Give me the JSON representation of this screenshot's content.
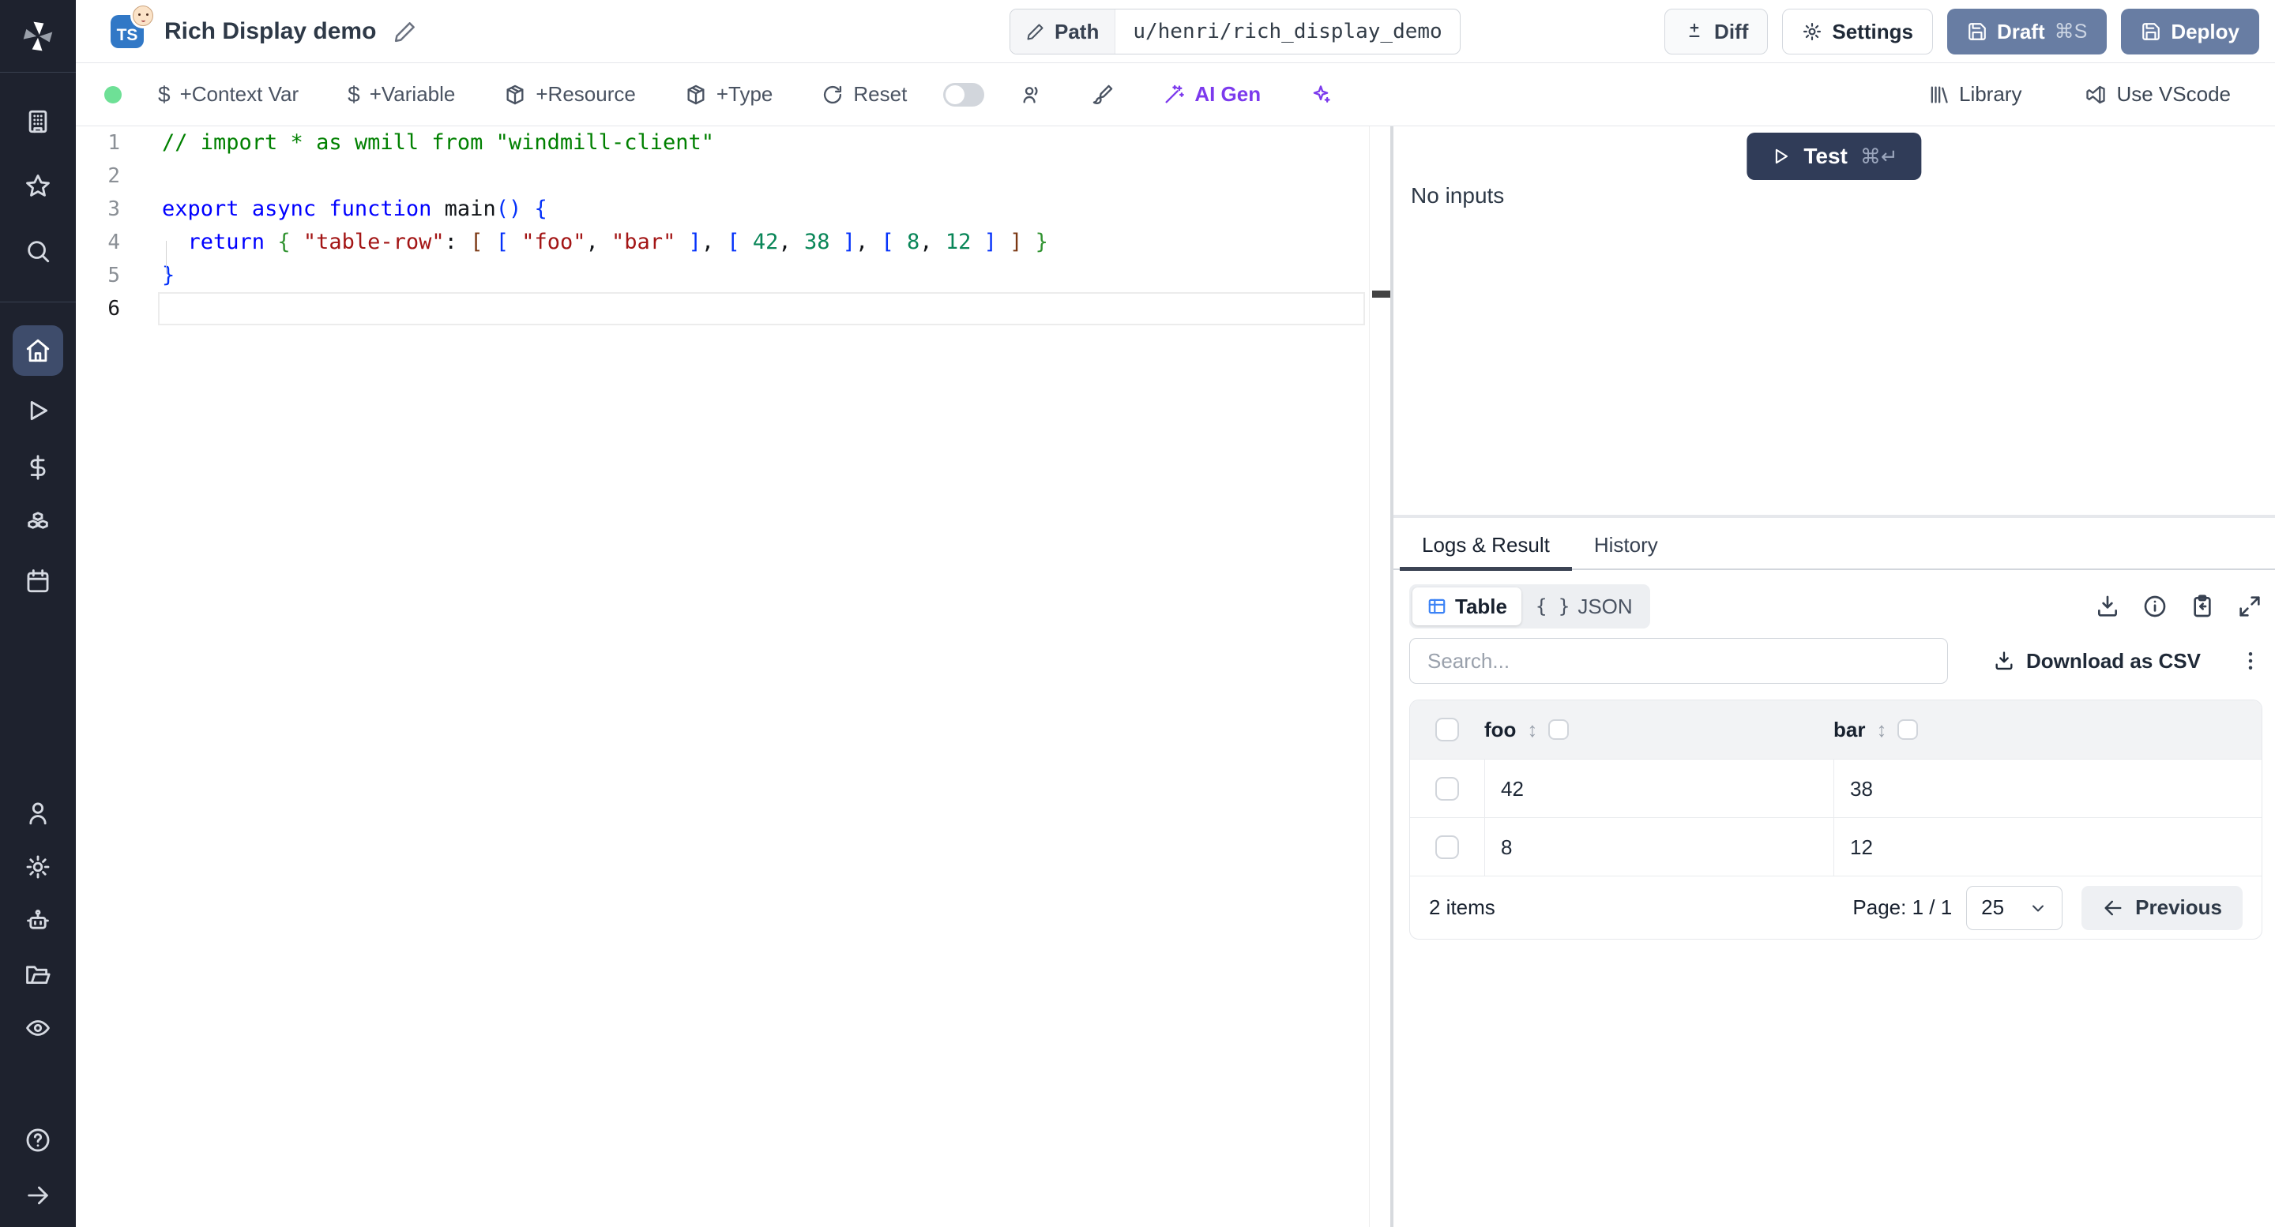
{
  "colors": {
    "sidebar_bg": "#1e222e",
    "sidebar_active_bg": "#3e4c6b",
    "primary_button": "#687da3",
    "test_button": "#303c58",
    "ai_accent": "#7c3aed",
    "ts_badge": "#3178c6",
    "status_green": "#6ee096",
    "table_icon_blue": "#3b82f6"
  },
  "sidebar": {
    "icons": [
      "windmill-logo",
      "building",
      "star",
      "search",
      "home",
      "play",
      "dollar",
      "boxes",
      "calendar",
      "user",
      "settings",
      "bot",
      "folder-open",
      "eye",
      "help",
      "expand-arrow"
    ]
  },
  "header": {
    "title": "Rich Display demo",
    "lang_badge": "TS",
    "path_label": "Path",
    "path_value": "u/henri/rich_display_demo",
    "diff_label": "Diff",
    "settings_label": "Settings",
    "draft_label": "Draft",
    "draft_shortcut": "⌘S",
    "deploy_label": "Deploy"
  },
  "toolbar": {
    "context_var": "+Context Var",
    "variable": "+Variable",
    "resource": "+Resource",
    "type": "+Type",
    "reset": "Reset",
    "ai_gen": "AI Gen",
    "library": "Library",
    "vscode": "Use VScode"
  },
  "editor": {
    "lines": [
      {
        "num": "1",
        "tokens": [
          {
            "t": "// import * as wmill from \"windmill-client\"",
            "c": "comment"
          }
        ]
      },
      {
        "num": "2",
        "tokens": []
      },
      {
        "num": "3",
        "tokens": [
          {
            "t": "export",
            "c": "kw"
          },
          {
            "t": " ",
            "c": "d"
          },
          {
            "t": "async",
            "c": "kw"
          },
          {
            "t": " ",
            "c": "d"
          },
          {
            "t": "function",
            "c": "kw"
          },
          {
            "t": " ",
            "c": "d"
          },
          {
            "t": "main",
            "c": "d"
          },
          {
            "t": "() {",
            "c": "b1"
          }
        ]
      },
      {
        "num": "4",
        "tokens": [
          {
            "t": "  ",
            "c": "d"
          },
          {
            "t": "return",
            "c": "kw"
          },
          {
            "t": " ",
            "c": "d"
          },
          {
            "t": "{",
            "c": "b2"
          },
          {
            "t": " ",
            "c": "d"
          },
          {
            "t": "\"table-row\"",
            "c": "str"
          },
          {
            "t": ": ",
            "c": "d"
          },
          {
            "t": "[",
            "c": "b3"
          },
          {
            "t": " ",
            "c": "d"
          },
          {
            "t": "[",
            "c": "b1"
          },
          {
            "t": " ",
            "c": "d"
          },
          {
            "t": "\"foo\"",
            "c": "str"
          },
          {
            "t": ", ",
            "c": "d"
          },
          {
            "t": "\"bar\"",
            "c": "str"
          },
          {
            "t": " ",
            "c": "d"
          },
          {
            "t": "]",
            "c": "b1"
          },
          {
            "t": ", ",
            "c": "d"
          },
          {
            "t": "[",
            "c": "b1"
          },
          {
            "t": " ",
            "c": "d"
          },
          {
            "t": "42",
            "c": "num"
          },
          {
            "t": ", ",
            "c": "d"
          },
          {
            "t": "38",
            "c": "num"
          },
          {
            "t": " ",
            "c": "d"
          },
          {
            "t": "]",
            "c": "b1"
          },
          {
            "t": ", ",
            "c": "d"
          },
          {
            "t": "[",
            "c": "b1"
          },
          {
            "t": " ",
            "c": "d"
          },
          {
            "t": "8",
            "c": "num"
          },
          {
            "t": ", ",
            "c": "d"
          },
          {
            "t": "12",
            "c": "num"
          },
          {
            "t": " ",
            "c": "d"
          },
          {
            "t": "]",
            "c": "b1"
          },
          {
            "t": " ",
            "c": "d"
          },
          {
            "t": "]",
            "c": "b3"
          },
          {
            "t": " ",
            "c": "d"
          },
          {
            "t": "}",
            "c": "b2"
          }
        ]
      },
      {
        "num": "5",
        "tokens": [
          {
            "t": "}",
            "c": "b1"
          }
        ]
      },
      {
        "num": "6",
        "active": true,
        "tokens": []
      }
    ]
  },
  "preview_panel": {
    "test_label": "Test",
    "test_shortcut": "⌘↵",
    "no_inputs": "No inputs"
  },
  "result_panel": {
    "tabs": [
      {
        "label": "Logs & Result"
      },
      {
        "label": "History"
      }
    ],
    "view_toggle": [
      {
        "label": "Table"
      },
      {
        "label": "JSON"
      }
    ],
    "icons": [
      "download",
      "info",
      "clipboard-copy",
      "expand"
    ]
  },
  "result_table": {
    "search_placeholder": "Search...",
    "download_csv_label": "Download as CSV",
    "columns": [
      "foo",
      "bar"
    ],
    "rows": [
      [
        "42",
        "38"
      ],
      [
        "8",
        "12"
      ]
    ],
    "items_label": "2 items",
    "page_label": "Page: 1 / 1",
    "page_size": "25",
    "previous_label": "Previous"
  }
}
